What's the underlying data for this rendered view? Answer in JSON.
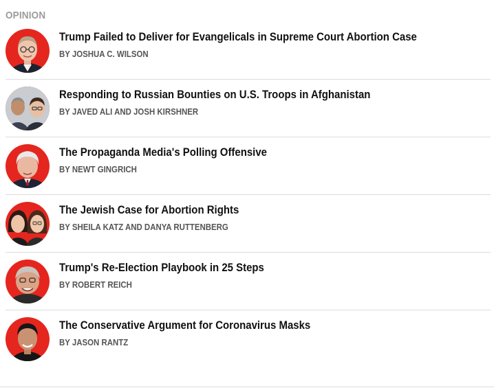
{
  "section": {
    "label": "OPINION"
  },
  "articles": [
    {
      "headline": "Trump Failed to Deliver for Evangelicals in Supreme Court Abortion Case",
      "byline": "BY JOSHUA C. WILSON"
    },
    {
      "headline": "Responding to Russian Bounties on U.S. Troops in Afghanistan",
      "byline": "BY JAVED ALI AND JOSH KIRSHNER"
    },
    {
      "headline": "The Propaganda Media's Polling Offensive",
      "byline": "BY NEWT GINGRICH"
    },
    {
      "headline": "The Jewish Case for Abortion Rights",
      "byline": "BY SHEILA KATZ AND DANYA RUTTENBERG"
    },
    {
      "headline": "Trump's Re-Election Playbook in 25 Steps",
      "byline": "BY ROBERT REICH"
    },
    {
      "headline": "The Conservative Argument for Coronavirus Masks",
      "byline": "BY JASON RANTZ"
    }
  ],
  "colors": {
    "avatar_background": "#e5261e",
    "section_label": "#9b9b9b",
    "headline": "#111111",
    "byline": "#555555",
    "divider": "#dcdcdc"
  }
}
